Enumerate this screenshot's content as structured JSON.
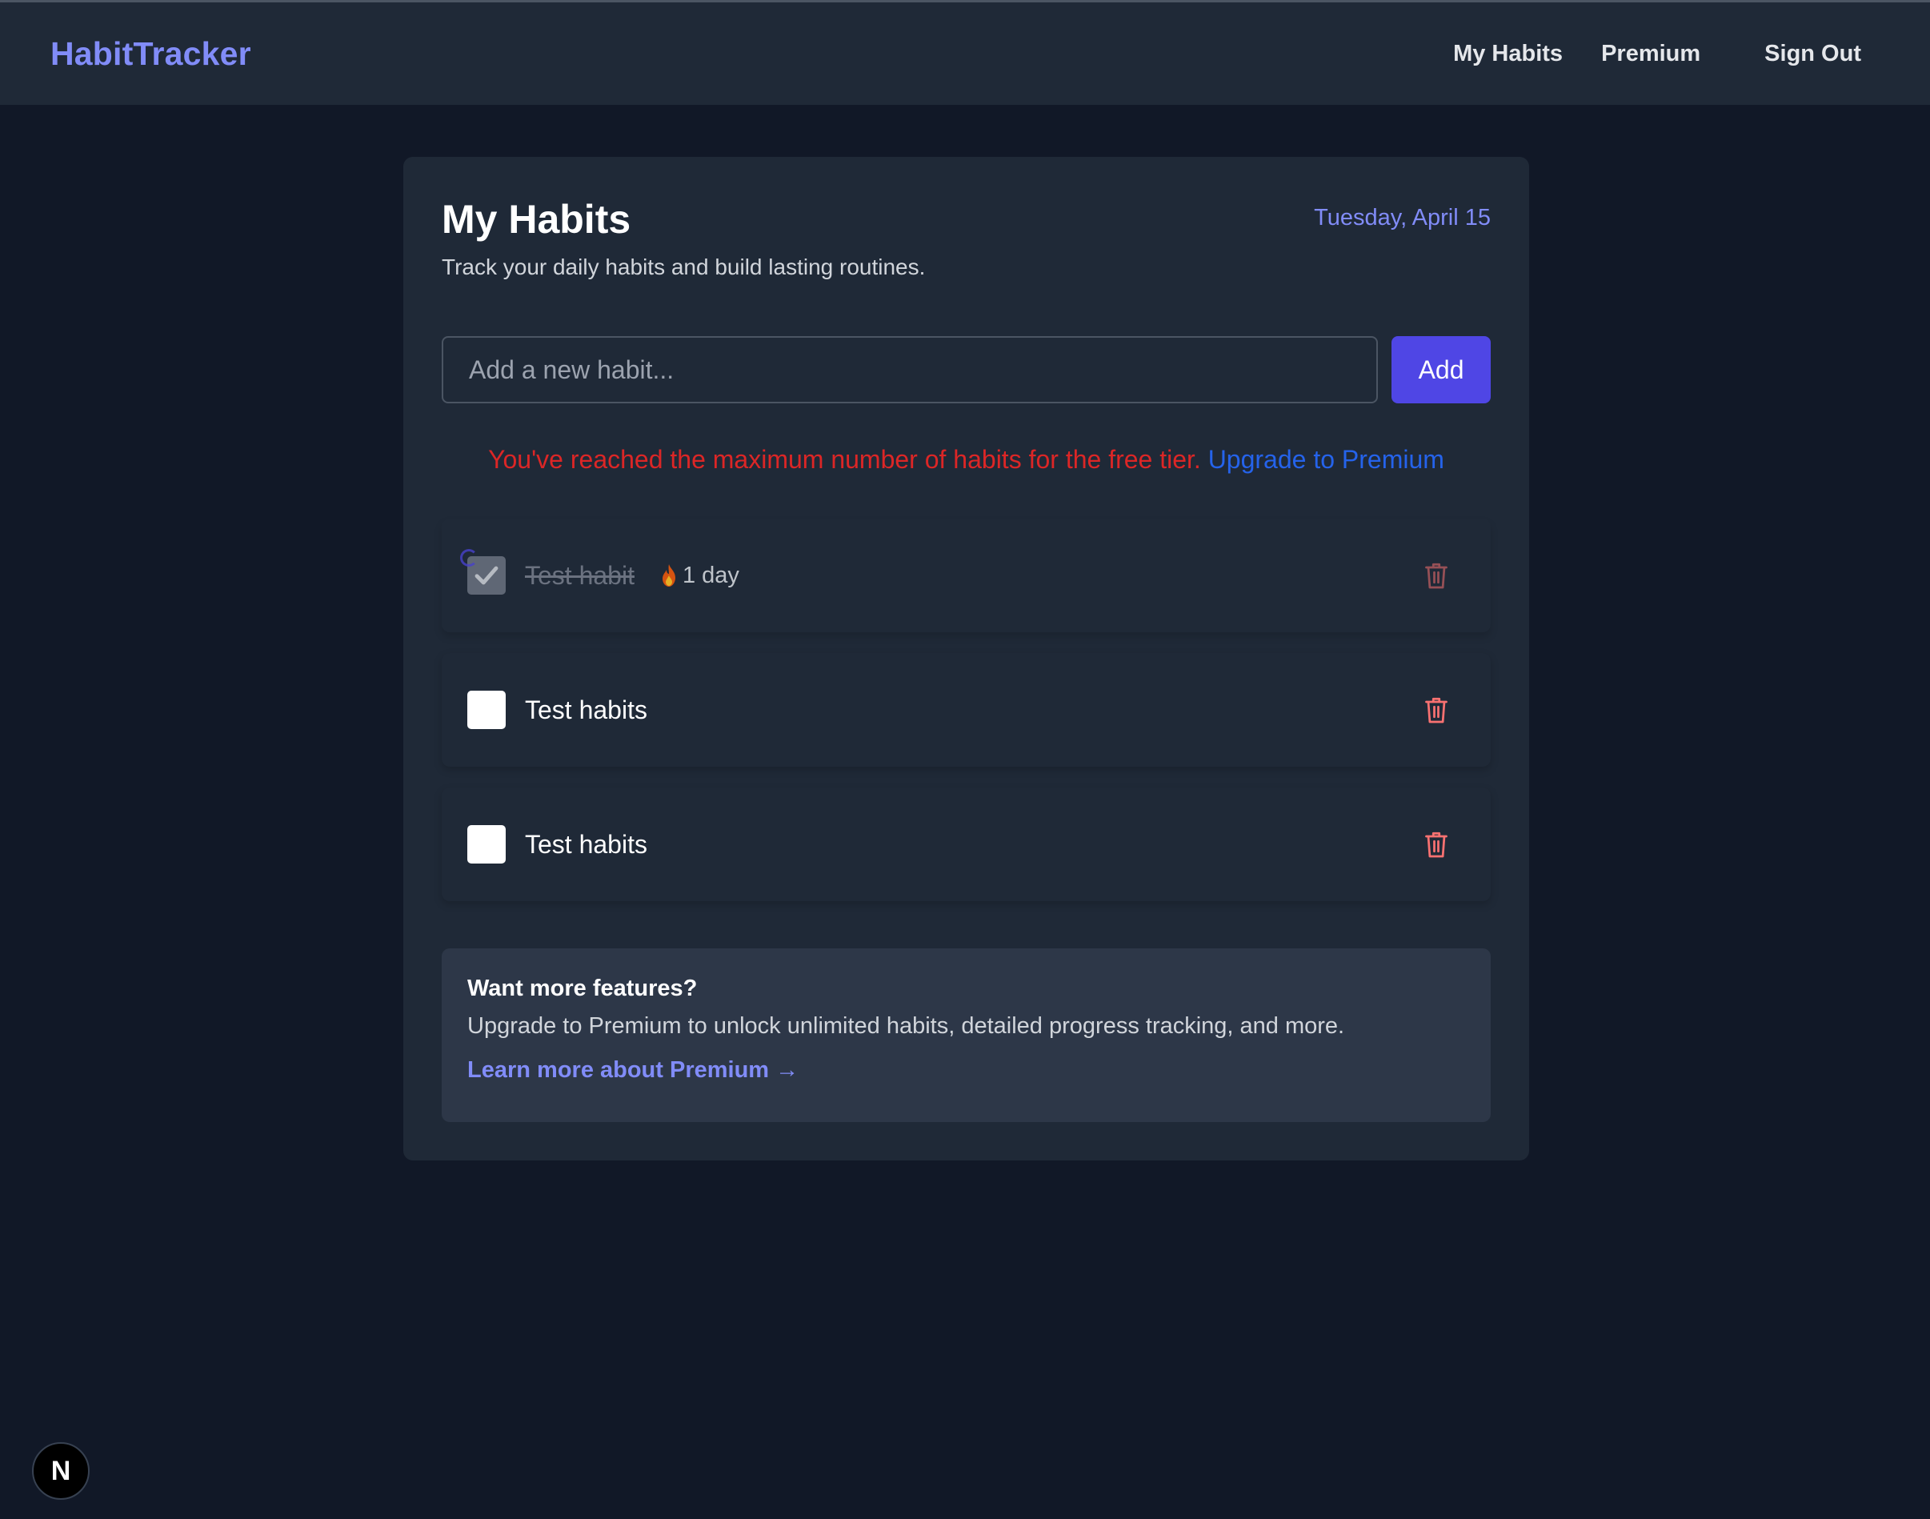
{
  "nav": {
    "brand": "HabitTracker",
    "links": [
      "My Habits",
      "Premium",
      "Sign Out"
    ]
  },
  "main": {
    "title": "My Habits",
    "date": "Tuesday, April 15",
    "subtitle": "Track your daily habits and build lasting routines.",
    "input_placeholder": "Add a new habit...",
    "add_label": "Add",
    "limit_message": "You've reached the maximum number of habits for the free tier.",
    "upgrade_link": "Upgrade to Premium"
  },
  "habits": [
    {
      "name": "Test habit",
      "completed": true,
      "streak": "1 day"
    },
    {
      "name": "Test habits",
      "completed": false
    },
    {
      "name": "Test habits",
      "completed": false
    }
  ],
  "promo": {
    "title": "Want more features?",
    "text": "Upgrade to Premium to unlock unlimited habits, detailed progress tracking, and more.",
    "link": "Learn more about Premium →"
  },
  "badge": {
    "label": "N"
  },
  "colors": {
    "background": "#111827",
    "surface": "#1f2937",
    "accent": "#818cf8",
    "primary_button": "#4f46e5",
    "error": "#dc2626",
    "link": "#2563eb",
    "delete": "#f87171"
  },
  "icons": [
    "check-icon",
    "fire-icon",
    "trash-icon"
  ]
}
